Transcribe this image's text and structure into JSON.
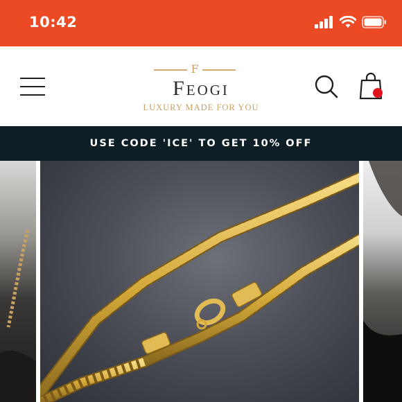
{
  "status_bar": {
    "time": "10:42",
    "icons": [
      "cellular-signal-icon",
      "wifi-icon",
      "battery-icon"
    ],
    "background_color": "#ec4a25"
  },
  "header": {
    "menu_icon": "hamburger-menu-icon",
    "logo": {
      "mark": "F",
      "name": "Feogi",
      "tagline": "LUXURY MADE FOR YOU"
    },
    "search_icon": "search-icon",
    "cart_icon": "shopping-bag-icon",
    "cart_badge_color": "#e0141c"
  },
  "promo_banner": {
    "text": "USE CODE 'ICE' TO GET 10% OFF",
    "background_color": "#0d1e27"
  },
  "carousel": {
    "slides": [
      {
        "name": "previous-slide",
        "content": "man-wearing-rope-chain"
      },
      {
        "name": "current-slide",
        "content": "gold-rope-chain-necklace"
      },
      {
        "name": "next-slide",
        "content": "man-wearing-chain"
      }
    ],
    "accent_color": "#d4a93a"
  }
}
